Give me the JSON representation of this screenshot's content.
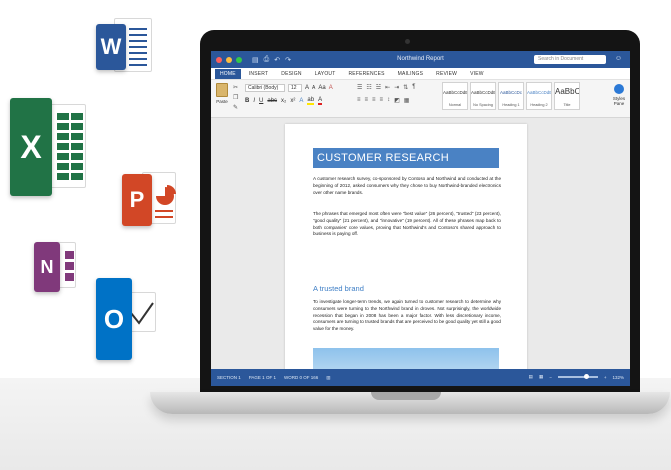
{
  "apps": [
    {
      "name": "Word",
      "letter": "W",
      "color": "#2b579a"
    },
    {
      "name": "Excel",
      "letter": "X",
      "color": "#217346"
    },
    {
      "name": "PowerPoint",
      "letter": "P",
      "color": "#d24726"
    },
    {
      "name": "OneNote",
      "letter": "N",
      "color": "#80397b"
    },
    {
      "name": "Outlook",
      "letter": "O",
      "color": "#0072c6"
    }
  ],
  "window": {
    "title": "Northwind Report",
    "search_placeholder": "Search in Document"
  },
  "tabs": [
    "HOME",
    "INSERT",
    "DESIGN",
    "LAYOUT",
    "REFERENCES",
    "MAILINGS",
    "REVIEW",
    "VIEW"
  ],
  "active_tab": "HOME",
  "ribbon": {
    "paste_label": "Paste",
    "font_name": "Calibri (Body)",
    "font_size": "12",
    "styles": [
      {
        "sample": "AaBbCcDdEe",
        "name": "Normal"
      },
      {
        "sample": "AaBbCcDdEe",
        "name": "No Spacing"
      },
      {
        "sample": "AaBbCcDc",
        "name": "Heading 1"
      },
      {
        "sample": "AaBbCcDdE",
        "name": "Heading 2"
      },
      {
        "sample": "AaBbC",
        "name": "Title"
      }
    ],
    "styles_pane_label": "Styles Pane"
  },
  "document": {
    "heading": "CUSTOMER RESEARCH",
    "para1": "A customer research survey, co-sponsored by Contoso and Northwind and conducted at the beginning of 2012, asked consumers why they chose to buy Northwind-branded electronics over other name brands.",
    "para2": "The phrases that emerged most often were \"best value\" (26 percent), \"trusted\" (23 percent), \"good quality\" (21 percent), and \"innovative\" (19 percent). All of these phrases map back to both companies' core values, proving that Northwind's and Contoso's shared approach to business is paying off.",
    "subheading": "A trusted brand",
    "para3": "To investigate longer-term trends, we again turned to customer research to determine why consumers were turning to the Northwind brand in droves. Not surprisingly, the worldwide recession that began in 2008 has been a major factor. With less discretionary income, consumers are turning to trusted brands that are perceived to be good quality yet still a good value for the money."
  },
  "status": {
    "section": "SECTION 1",
    "page": "PAGE 1 OF 1",
    "words": "WORD 0 OF 166",
    "zoom": "132%"
  },
  "colors": {
    "word_blue": "#2b579a",
    "heading_blue": "#4a82c4"
  }
}
